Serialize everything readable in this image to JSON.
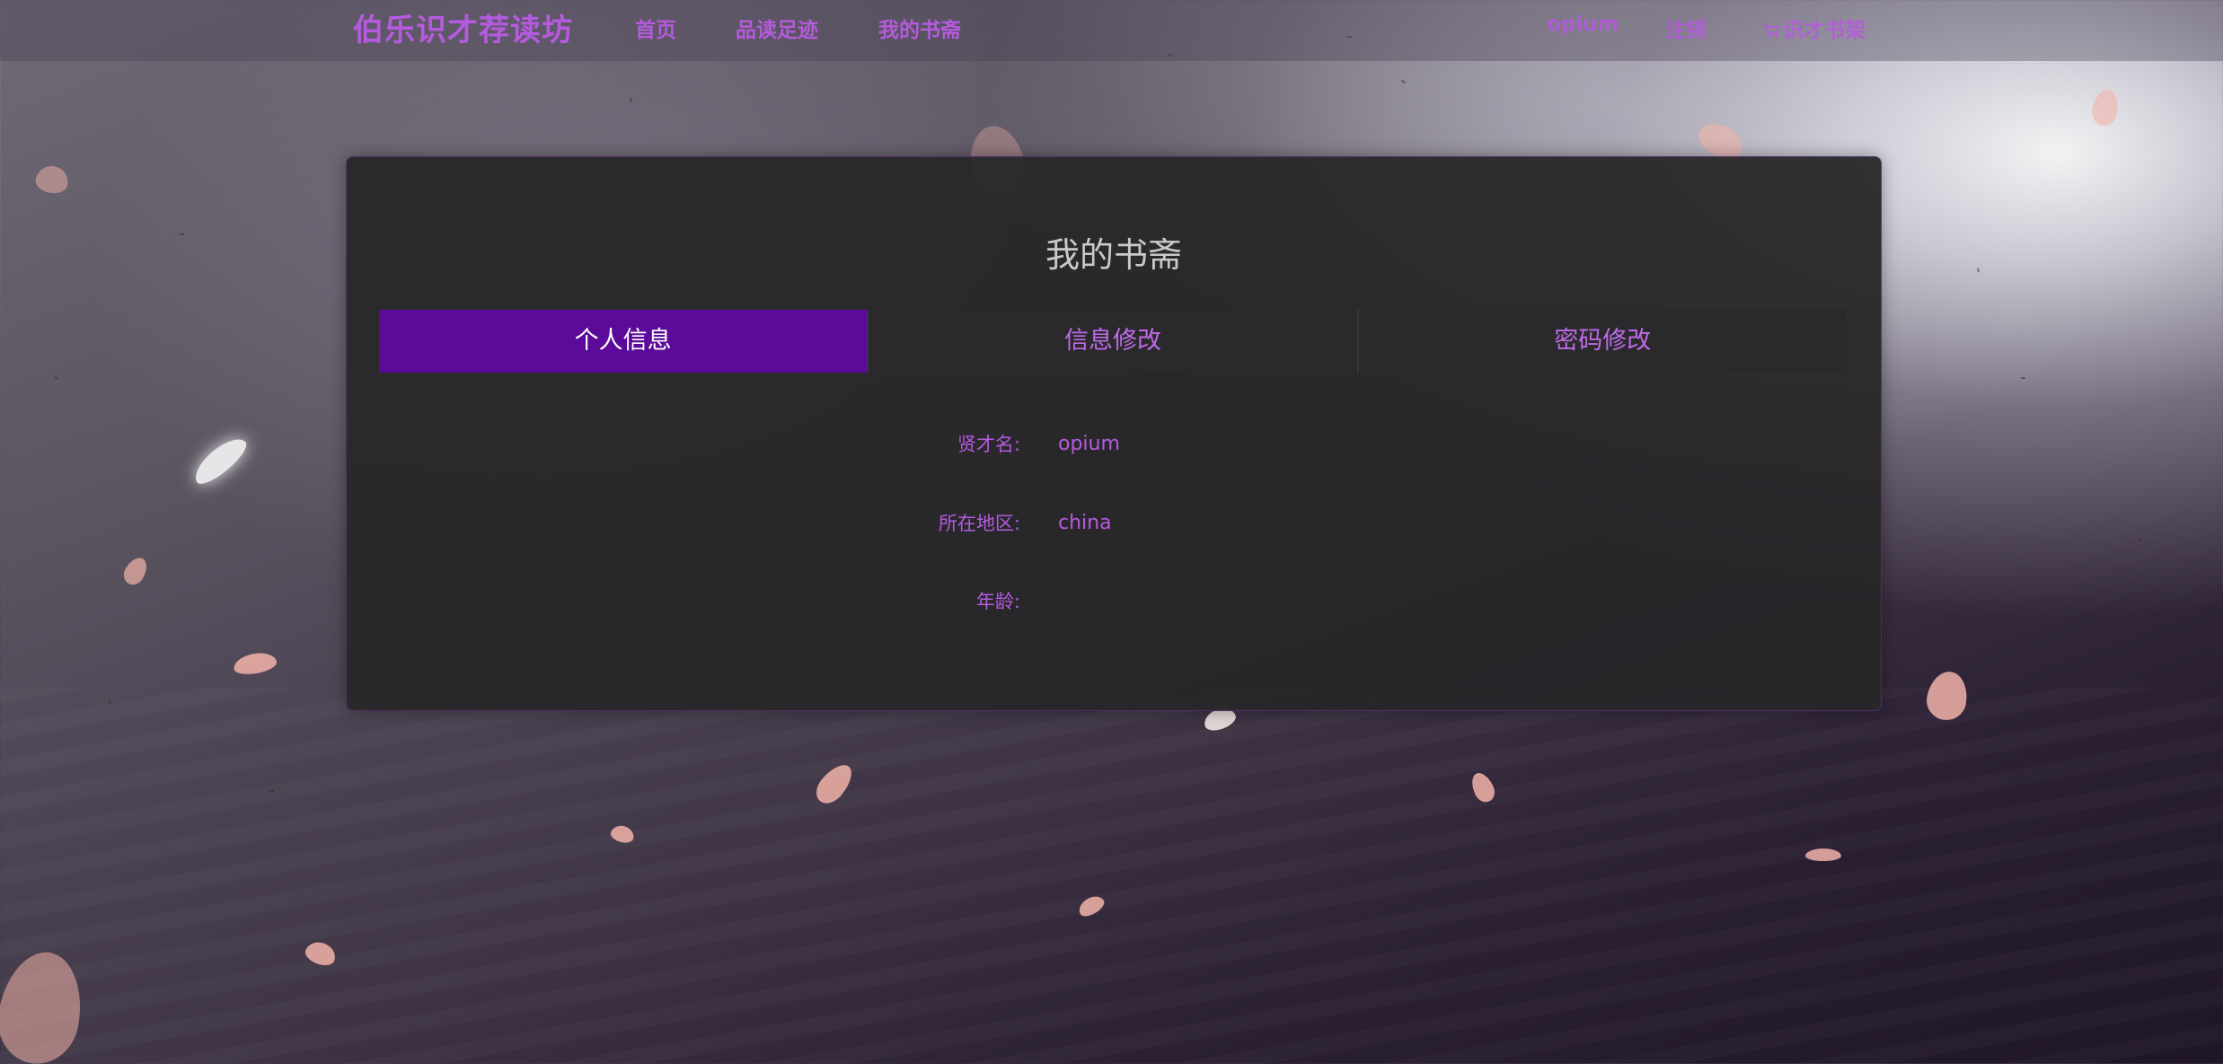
{
  "brand": "伯乐识才荐读坊",
  "nav": {
    "home": "首页",
    "reading_trail": "品读足迹",
    "my_study": "我的书斋",
    "username": "opium",
    "logout": "注销",
    "bookshelf": "识才书架"
  },
  "panel": {
    "title": "我的书斋",
    "tabs": [
      {
        "label": "个人信息",
        "active": true
      },
      {
        "label": "信息修改",
        "active": false
      },
      {
        "label": "密码修改",
        "active": false
      }
    ],
    "fields": [
      {
        "label": "贤才名:",
        "value": "opium"
      },
      {
        "label": "所在地区:",
        "value": "china"
      },
      {
        "label": "年龄:",
        "value": ""
      }
    ]
  },
  "colors": {
    "accent": "#b65ae0",
    "active_tab": "#5c0a9a",
    "panel_bg": "#262628"
  },
  "icons": {
    "bookshelf": "cart-icon"
  }
}
